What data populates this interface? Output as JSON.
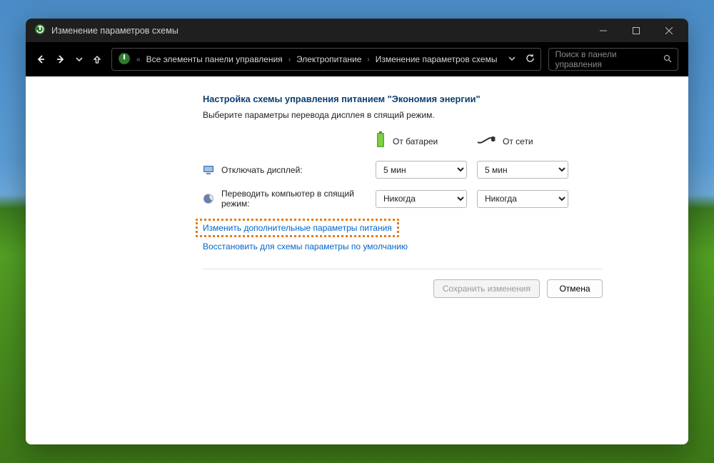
{
  "window": {
    "title": "Изменение параметров схемы"
  },
  "breadcrumbs": {
    "root_sep": "«",
    "items": [
      "Все элементы панели управления",
      "Электропитание",
      "Изменение параметров схемы"
    ]
  },
  "search": {
    "placeholder": "Поиск в панели управления"
  },
  "page": {
    "heading": "Настройка схемы управления питанием \"Экономия энергии\"",
    "subtitle": "Выберите параметры перевода дисплея в спящий режим.",
    "col_battery": "От батареи",
    "col_plug": "От сети"
  },
  "rows": {
    "display_off": {
      "label": "Отключать дисплей:",
      "battery": "5 мин",
      "plug": "5 мин"
    },
    "sleep": {
      "label": "Переводить компьютер в спящий режим:",
      "battery": "Никогда",
      "plug": "Никогда"
    }
  },
  "links": {
    "advanced": "Изменить дополнительные параметры питания",
    "restore": "Восстановить для схемы параметры по умолчанию"
  },
  "buttons": {
    "save": "Сохранить изменения",
    "cancel": "Отмена"
  }
}
